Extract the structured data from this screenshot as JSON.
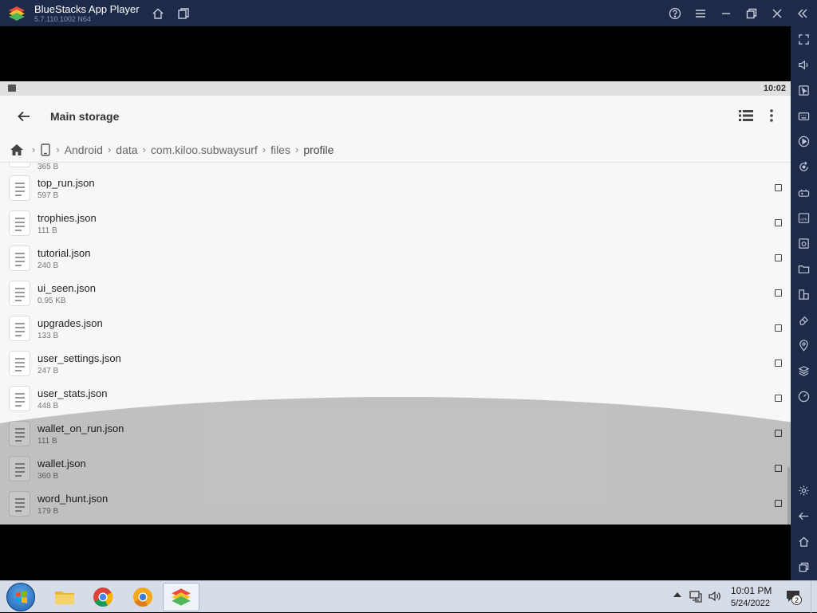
{
  "window": {
    "title": "BlueStacks App Player",
    "version": "5.7.110.1002 N64"
  },
  "android": {
    "status_time": "10:02",
    "appbar_title": "Main storage",
    "breadcrumb": [
      "Android",
      "data",
      "com.kiloo.subwaysurf",
      "files",
      "profile"
    ],
    "partial_row_size": "365 B",
    "files": [
      {
        "name": "top_run.json",
        "size": "597 B"
      },
      {
        "name": "trophies.json",
        "size": "111 B"
      },
      {
        "name": "tutorial.json",
        "size": "240 B"
      },
      {
        "name": "ui_seen.json",
        "size": "0.95 KB"
      },
      {
        "name": "upgrades.json",
        "size": "133 B"
      },
      {
        "name": "user_settings.json",
        "size": "247 B"
      },
      {
        "name": "user_stats.json",
        "size": "448 B"
      },
      {
        "name": "wallet_on_run.json",
        "size": "111 B"
      },
      {
        "name": "wallet.json",
        "size": "360 B"
      },
      {
        "name": "word_hunt.json",
        "size": "179 B"
      }
    ]
  },
  "taskbar": {
    "time": "10:01 PM",
    "date": "5/24/2022",
    "notification_count": "2",
    "apps": [
      "file-explorer",
      "chrome",
      "chrome-canary",
      "bluestacks"
    ]
  },
  "colors": {
    "titlebar": "#1e2a4a",
    "screen_bg": "#f7f7f7",
    "taskbar": "#d6dde8"
  }
}
